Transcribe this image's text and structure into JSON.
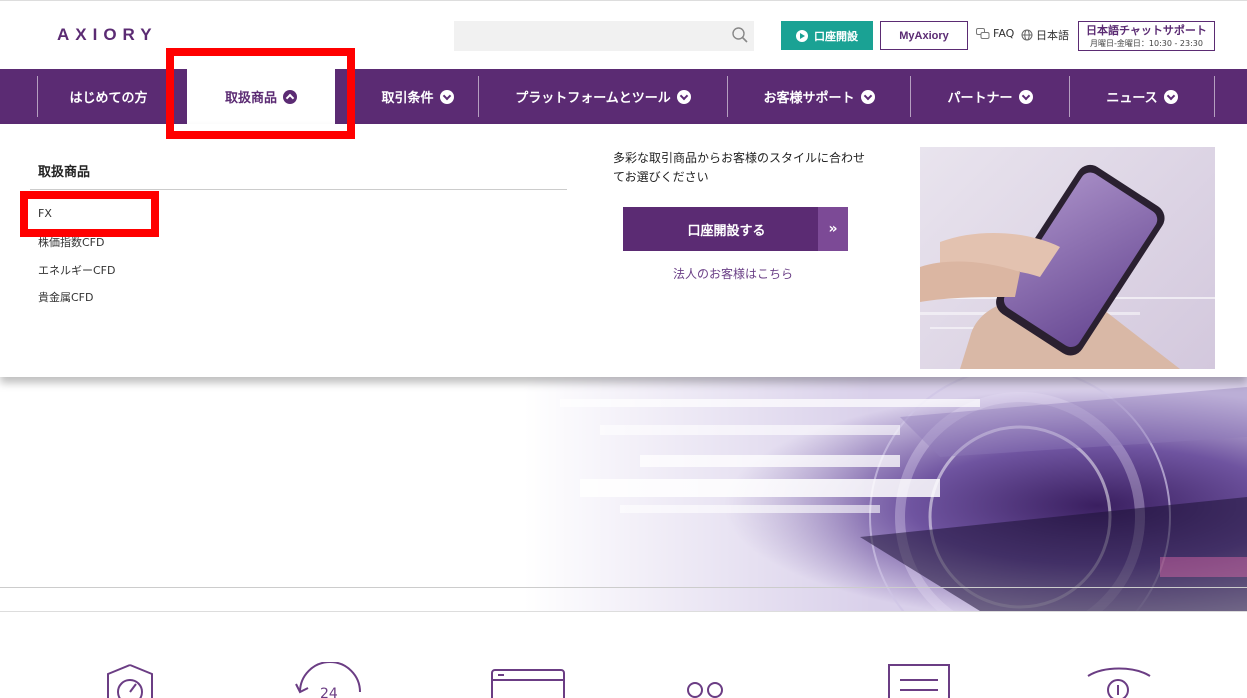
{
  "header": {
    "logo": "AXIORY",
    "search": {
      "value": "",
      "placeholder": ""
    },
    "open_account_label": "口座開設",
    "myaxiory_label": "MyAxiory",
    "faq_label": "FAQ",
    "language_label": "日本語",
    "chat_title": "日本語チャットサポート",
    "chat_hours": "月曜日-金曜日：10:30 - 23:30"
  },
  "nav": {
    "items": [
      {
        "label": "はじめての方"
      },
      {
        "label": "取扱商品",
        "active": true
      },
      {
        "label": "取引条件"
      },
      {
        "label": "プラットフォームとツール"
      },
      {
        "label": "お客様サポート"
      },
      {
        "label": "パートナー"
      },
      {
        "label": "ニュース"
      }
    ]
  },
  "dropdown": {
    "title": "取扱商品",
    "links": [
      "FX",
      "株価指数CFD",
      "エネルギーCFD",
      "貴金属CFD"
    ],
    "promo_text": "多彩な取引商品からお客様のスタイルに合わせてお選びください",
    "promo_button": "口座開設する",
    "promo_button_arrow": "»",
    "corporate_link": "法人のお客様はこちら"
  },
  "colors": {
    "brand_purple": "#5b2b73",
    "teal": "#1aa294",
    "annotation_red": "#ff0000"
  }
}
